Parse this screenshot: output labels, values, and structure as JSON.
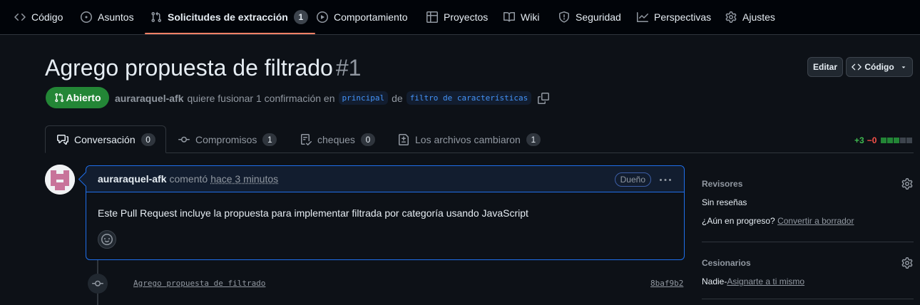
{
  "nav": {
    "items": [
      {
        "label": "Código",
        "icon": "code-icon"
      },
      {
        "label": "Asuntos",
        "icon": "issue-opened-icon"
      },
      {
        "label": "Solicitudes de extracción",
        "icon": "git-pull-request-icon",
        "counter": "1"
      },
      {
        "label": "Comportamiento",
        "icon": "play-icon"
      },
      {
        "label": "Proyectos",
        "icon": "table-icon"
      },
      {
        "label": "Wiki",
        "icon": "book-icon"
      },
      {
        "label": "Seguridad",
        "icon": "shield-icon"
      },
      {
        "label": "Perspectivas",
        "icon": "graph-icon"
      },
      {
        "label": "Ajustes",
        "icon": "gear-icon"
      }
    ]
  },
  "header": {
    "title": "Agrego propuesta de filtrado",
    "number": "#1",
    "edit_label": "Editar",
    "code_label": "Código"
  },
  "status": {
    "state": "Abierto",
    "author": "auraraquel-afk",
    "text_before": "quiere fusionar 1 confirmación en",
    "base_branch": "principal",
    "connector": "de",
    "head_branch": "filtro de características"
  },
  "tabs": [
    {
      "label": "Conversación",
      "count": "0",
      "icon": "comment-discussion-icon"
    },
    {
      "label": "Compromisos",
      "count": "1",
      "icon": "git-commit-icon"
    },
    {
      "label": "cheques",
      "count": "0",
      "icon": "checklist-icon"
    },
    {
      "label": "Los archivos cambiaron",
      "count": "1",
      "icon": "file-diff-icon"
    }
  ],
  "diffstat": {
    "additions": "+3",
    "deletions": "−0"
  },
  "comment": {
    "author": "auraraquel-afk",
    "action": "comentó",
    "time": "hace 3 minutos",
    "badge": "Dueño",
    "body": "Este Pull Request incluye la propuesta para implementar filtrada por categoría usando JavaScript"
  },
  "timeline": {
    "commit_message": "Agrego propuesta de filtrado",
    "commit_sha": "8baf9b2"
  },
  "sidebar": {
    "reviewers": {
      "heading": "Revisores",
      "value": "Sin reseñas",
      "prompt": "¿Aún en progreso?",
      "link": "Convertir a borrador"
    },
    "assignees": {
      "heading": "Cesionarios",
      "value": "Nadie-",
      "link": "Asignarte a ti mismo"
    }
  },
  "colors": {
    "accent": "#f78166",
    "open": "#238636",
    "link": "#4493f8",
    "add": "#3fb950",
    "del": "#f85149"
  }
}
